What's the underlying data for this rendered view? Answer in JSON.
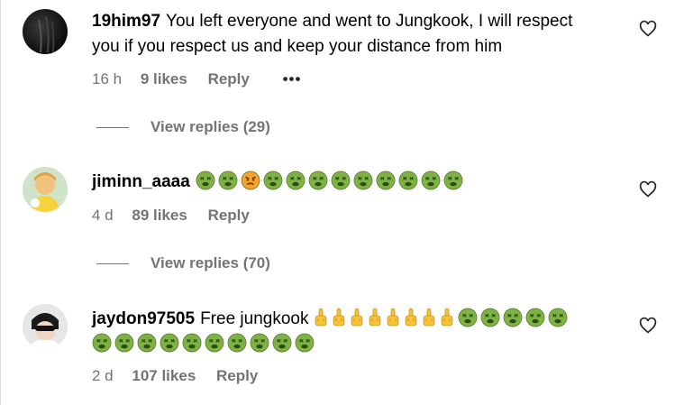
{
  "comments": [
    {
      "username": "19him97",
      "text": "You left everyone and went to Jungkook, I will respect you if you respect us and keep your distance from him",
      "time": "16 h",
      "likes": "9 likes",
      "reply": "Reply",
      "more": "•••",
      "view_replies": "View replies (29)"
    },
    {
      "username": "jiminn_aaaa",
      "text": "",
      "emojis": [
        "nauseated",
        "nauseated",
        "angry",
        "nauseated",
        "nauseated",
        "nauseated",
        "nauseated",
        "nauseated",
        "nauseated",
        "nauseated",
        "nauseated",
        "nauseated"
      ],
      "time": "4 d",
      "likes": "89 likes",
      "reply": "Reply",
      "view_replies": "View replies (70)"
    },
    {
      "username": "jaydon97505",
      "text": "Free jungkook",
      "fingers": 8,
      "emojis_line1": 5,
      "emojis_line2": 10,
      "time": "2 d",
      "likes": "107 likes",
      "reply": "Reply"
    }
  ],
  "colors": {
    "meta_gray": "#737373",
    "nauseated_green": "#7cb342",
    "angry_orange": "#f4a32a",
    "finger_yellow": "#f7c23b"
  },
  "icons": [
    "heart-outline-icon",
    "more-options-icon"
  ]
}
